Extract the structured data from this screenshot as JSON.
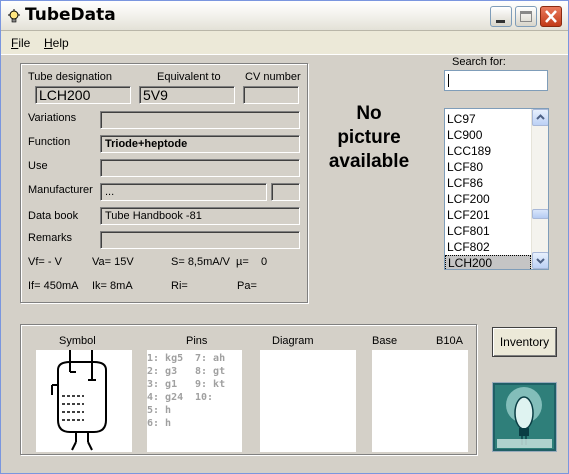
{
  "window": {
    "title": "TubeData"
  },
  "menu": [
    {
      "label": "File",
      "mnemonic": "F",
      "rest": "ile"
    },
    {
      "label": "Help",
      "mnemonic": "H",
      "rest": "elp"
    }
  ],
  "header_labels": {
    "designation": "Tube designation",
    "equivalent": "Equivalent to",
    "cv": "CV number"
  },
  "fields": {
    "designation": "LCH200",
    "equivalent": "5V9",
    "cv": "",
    "variations_label": "Variations",
    "variations": "",
    "function_label": "Function",
    "function": "Triode+heptode",
    "use_label": "Use",
    "use": "",
    "manufacturer_label": "Manufacturer",
    "manufacturer": "...",
    "manufacturer_code": "",
    "databook_label": "Data book",
    "databook": "Tube Handbook -81",
    "remarks_label": "Remarks",
    "remarks": ""
  },
  "params": {
    "vf": "Vf= - V",
    "va": "Va= 15V",
    "s": "S= 8,5mA/V",
    "mu": "µ=",
    "mu_val": "0",
    "if": "If= 450mA",
    "ik": "Ik= 8mA",
    "ri": "Ri=",
    "pa": "Pa="
  },
  "no_picture": [
    "No",
    "picture",
    "available"
  ],
  "search": {
    "label": "Search for:",
    "value": ""
  },
  "tube_list": [
    "LC97",
    "LC900",
    "LCC189",
    "LCF80",
    "LCF86",
    "LCF200",
    "LCF201",
    "LCF801",
    "LCF802",
    "LCH200"
  ],
  "selected_tube": "LCH200",
  "bottom_labels": {
    "symbol": "Symbol",
    "pins": "Pins",
    "diagram": "Diagram",
    "base": "Base",
    "base_code": "B10A"
  },
  "pins": [
    "1: kg5",
    "2: g3",
    "3: g1",
    "4: g24",
    "5: h",
    "6: h",
    "7: ah",
    "8: gt",
    "9: kt",
    "10:"
  ],
  "inventory_button": "Inventory",
  "colors": {
    "dialog_bg": "#d4d0c8",
    "titlebar_close": "#c23a17",
    "list_selection": "#c5c5c5",
    "pin_text": "#a0a0a0"
  },
  "icons": [
    "bulb-icon",
    "minimize-icon",
    "maximize-icon",
    "close-icon",
    "scroll-up-icon",
    "scroll-down-icon",
    "tube-symbol-icon",
    "logo-icon"
  ]
}
